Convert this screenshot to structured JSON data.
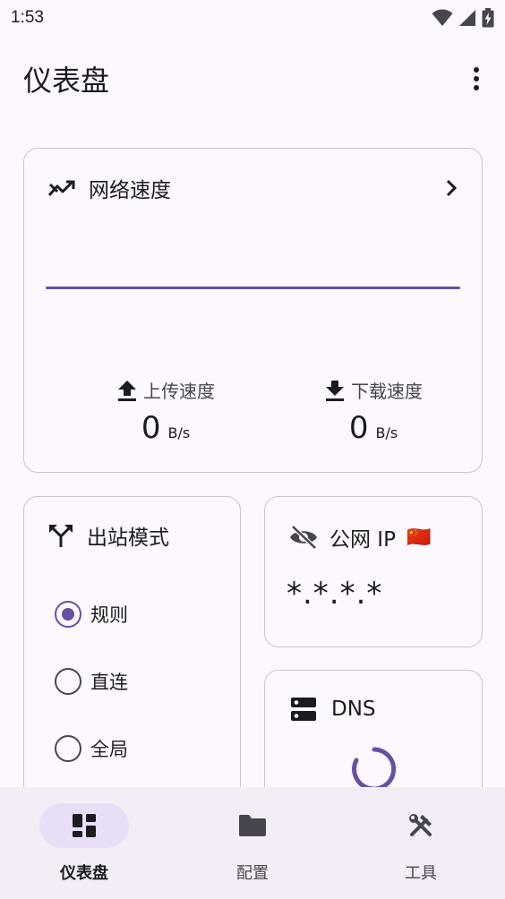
{
  "status_bar": {
    "time": "1:53",
    "icons": [
      "wifi-icon",
      "cellular-signal-icon",
      "battery-charging-icon"
    ]
  },
  "app_bar": {
    "title": "仪表盘",
    "menu_icon": "more-vert-icon"
  },
  "speed_card": {
    "title": "网络速度",
    "icon": "trending-icon",
    "chevron_icon": "chevron-right-icon",
    "upload": {
      "label": "上传速度",
      "value": "0",
      "unit": "B/s",
      "icon": "upload-icon"
    },
    "download": {
      "label": "下载速度",
      "value": "0",
      "unit": "B/s",
      "icon": "download-icon"
    }
  },
  "outbound_card": {
    "title": "出站模式",
    "icon": "call-split-icon",
    "options": [
      {
        "label": "规则",
        "selected": true
      },
      {
        "label": "直连",
        "selected": false
      },
      {
        "label": "全局",
        "selected": false
      }
    ]
  },
  "ip_card": {
    "title": "公网 IP",
    "flag": "🇨🇳",
    "icon": "visibility-off-icon",
    "value": "*.*.*.*"
  },
  "dns_card": {
    "title": "DNS",
    "icon": "dns-icon"
  },
  "nav": {
    "items": [
      {
        "label": "仪表盘",
        "icon": "dashboard-icon",
        "active": true
      },
      {
        "label": "配置",
        "icon": "folder-icon",
        "active": false
      },
      {
        "label": "工具",
        "icon": "tools-icon",
        "active": false
      }
    ]
  },
  "colors": {
    "primary": "#6750a4",
    "background": "#fdf7fe",
    "nav_background": "#f3edf7",
    "active_indicator": "#e8def8",
    "outline": "#cac4d0"
  }
}
